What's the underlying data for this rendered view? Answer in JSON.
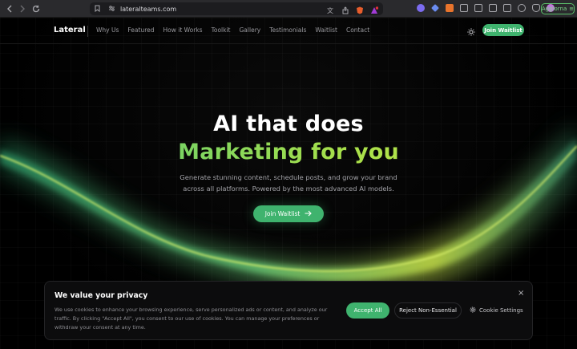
{
  "browser": {
    "url": "lateralteams.com",
    "update_label": "Aggiorna"
  },
  "nav": {
    "logo": "Lateral",
    "links": [
      "Why Us",
      "Featured",
      "How it Works",
      "Toolkit",
      "Gallery",
      "Testimonials",
      "Waitlist",
      "Contact"
    ],
    "cta": "Join Waitlist"
  },
  "hero": {
    "title_line1": "AI that does",
    "title_line2": "Marketing for you",
    "subtitle_line1": "Generate stunning content, schedule posts, and grow your brand",
    "subtitle_line2": "across all platforms. Powered by the most advanced AI models.",
    "cta": "Join Waitlist"
  },
  "cookie": {
    "title": "We value your privacy",
    "body": "We use cookies to enhance your browsing experience, serve personalized ads or content, and analyze our traffic. By clicking \"Accept All\", you consent to our use of cookies. You can manage your preferences or withdraw your consent at any time.",
    "accept": "Accept All",
    "reject": "Reject Non-Essential",
    "settings": "Cookie Settings",
    "close": "×"
  },
  "colors": {
    "accent": "#3fb36e",
    "gradient_start": "#4cc77c",
    "gradient_end": "#c9e84a"
  }
}
